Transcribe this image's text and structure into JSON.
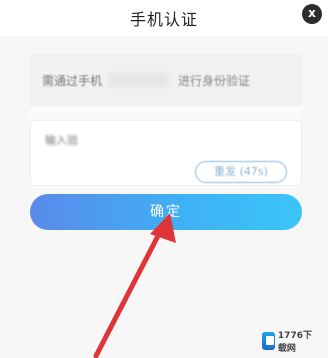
{
  "header": {
    "title": "手机认证",
    "close_label": "x"
  },
  "form": {
    "info_left": "需通过手机",
    "info_right": "进行身份验证",
    "code_placeholder": "输入验",
    "resend_label": "重发 (47s)",
    "confirm_label": "确定"
  },
  "watermark": {
    "text": "1776下载网"
  },
  "colors": {
    "confirm_gradient_start": "#5a89ea",
    "confirm_gradient_end": "#3bc5f7",
    "arrow": "#e0343a"
  }
}
